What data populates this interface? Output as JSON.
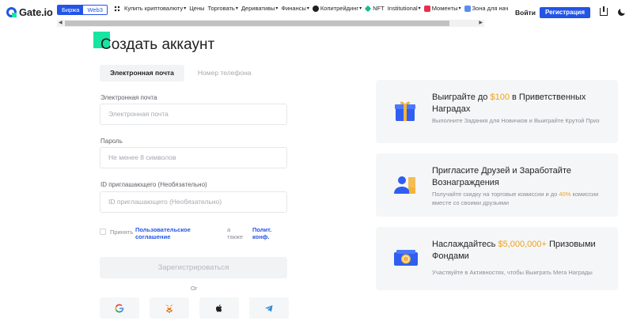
{
  "nav": {
    "logo": "Gate.io",
    "mode_active": "Биржа",
    "mode_inactive": "Web3",
    "menu": [
      {
        "label": "Купить криптовалюту"
      },
      {
        "label": "Цены"
      },
      {
        "label": "Торговать"
      },
      {
        "label": "Деривативы"
      },
      {
        "label": "Финансы"
      },
      {
        "label": "Копитрейдинг"
      },
      {
        "label": "NFT"
      },
      {
        "label": "Institutional"
      },
      {
        "label": "Моменты"
      },
      {
        "label": "Зона для нач"
      }
    ],
    "login": "Войти",
    "register": "Регистрация"
  },
  "form": {
    "title": "Создать аккаунт",
    "tab_email": "Электронная почта",
    "tab_phone": "Номер телефона",
    "email_label": "Электронная почта",
    "email_placeholder": "Электронная почта",
    "password_label": "Пароль",
    "password_placeholder": "Не менее 8 символов",
    "referral_label": "ID приглашающего (Необязательно)",
    "referral_placeholder": "ID приглашающего (Необязательно)",
    "agree_accept": "Принять",
    "agree_terms": "Пользовательское соглашение",
    "agree_also": "а также",
    "agree_privacy": "Полит. конф.",
    "submit": "Зарегистрироваться",
    "or": "Or"
  },
  "cards": [
    {
      "title_pre": "Выиграйте до ",
      "title_hl": "$100",
      "title_post": " в Приветственных Наградах",
      "sub_pre": "Выполните Задания для Новичков и Выиграйте Крутой Приз",
      "sub_hl": "",
      "sub_post": ""
    },
    {
      "title_pre": "Пригласите Друзей и Заработайте Вознаграждения",
      "title_hl": "",
      "title_post": "",
      "sub_pre": "Получайте скидку на торговые комиссии и до ",
      "sub_hl": "40%",
      "sub_post": " комиссии вместе со своими друзьями"
    },
    {
      "title_pre": "Наслаждайтесь ",
      "title_hl": "$5,000,000+",
      "title_post": " Призовыми Фондами",
      "sub_pre": "Участвуйте в Активностях, чтобы Выиграть Мега Награды",
      "sub_hl": "",
      "sub_post": ""
    }
  ],
  "colors": {
    "brand_blue": "#2354e6",
    "brand_green": "#17e5a1",
    "highlight_orange": "#f0a11b"
  }
}
